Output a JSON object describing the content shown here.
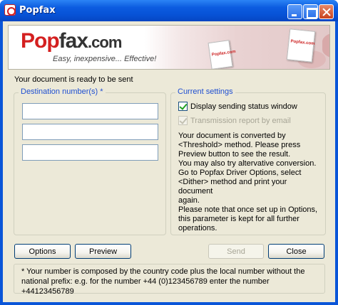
{
  "window": {
    "title": "Popfax"
  },
  "banner": {
    "logo_text_pop1": "Po",
    "logo_text_pop2": "p",
    "logo_text_fax": "fax",
    "logo_text_com": ".com",
    "slogan": "Easy, inexpensive... Effective!",
    "doc_stamp": "Popfax.com"
  },
  "status": {
    "message": "Your document  is ready to be sent"
  },
  "destination": {
    "legend": "Destination number(s) *",
    "fields": [
      "",
      "",
      ""
    ]
  },
  "settings": {
    "legend": "Current settings",
    "display_status_label": "Display sending status window",
    "display_status_checked": true,
    "transmission_report_label": "Transmission report by email",
    "transmission_report_checked": true,
    "transmission_report_enabled": false,
    "info": "Your document is converted by\n<Threshold> method. Please press\nPreview button to see the result.\nYou may also try altervative conversion.\nGo to Popfax Driver Options, select\n<Dither> method and print your document\nagain.\nPlease note that once set up in Options,\nthis parameter is kept for all further\noperations."
  },
  "buttons": {
    "options": "Options",
    "preview": "Preview",
    "send": "Send",
    "close": "Close"
  },
  "note": "* Your number is composed by the country code plus the local number without the national prefix: e.g. for the number +44 (0)123456789 enter the number +44123456789",
  "colors": {
    "title_bar": "#0a55d8",
    "legend": "#1f4fd1",
    "logo_red": "#d42020"
  }
}
